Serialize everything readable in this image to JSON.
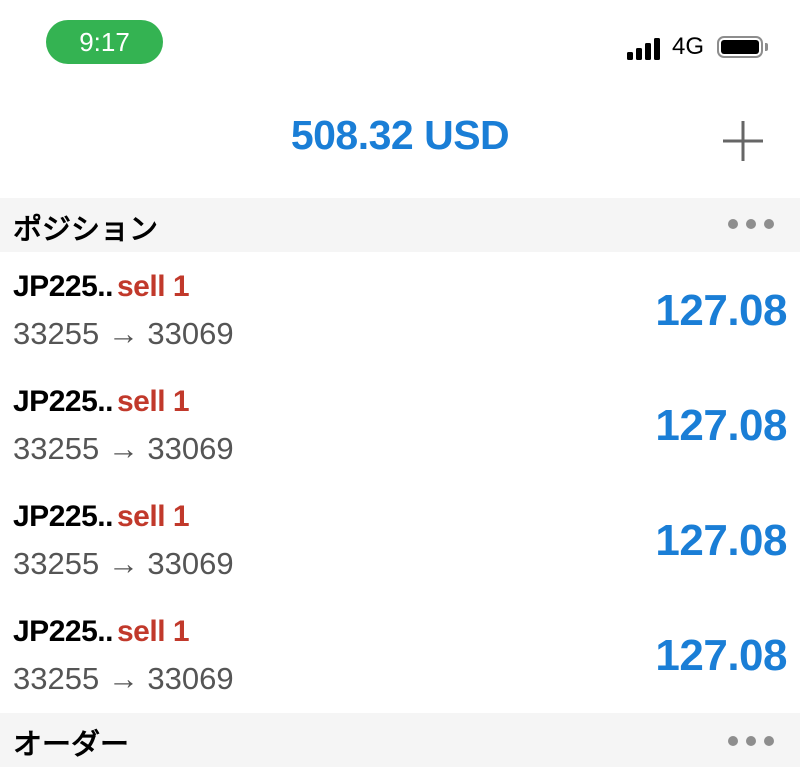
{
  "status_bar": {
    "time": "9:17",
    "network": "4G",
    "signal_icon": "signal-bars-icon",
    "battery_icon": "battery-icon",
    "time_pill_color": "#34b352"
  },
  "header": {
    "balance": "508.32 USD",
    "add_icon": "plus-icon",
    "accent_color": "#1a7ed6"
  },
  "positions": {
    "title": "ポジション",
    "more_icon": "more-horizontal-icon",
    "items": [
      {
        "symbol": "JP225..",
        "side": "sell 1",
        "prices": "33255 → 33069",
        "profit": "127.08"
      },
      {
        "symbol": "JP225..",
        "side": "sell 1",
        "prices": "33255 → 33069",
        "profit": "127.08"
      },
      {
        "symbol": "JP225..",
        "side": "sell 1",
        "prices": "33255 → 33069",
        "profit": "127.08"
      },
      {
        "symbol": "JP225..",
        "side": "sell 1",
        "prices": "33255 → 33069",
        "profit": "127.08"
      }
    ],
    "sell_color": "#c1392b"
  },
  "orders": {
    "title": "オーダー",
    "more_icon": "more-horizontal-icon"
  }
}
